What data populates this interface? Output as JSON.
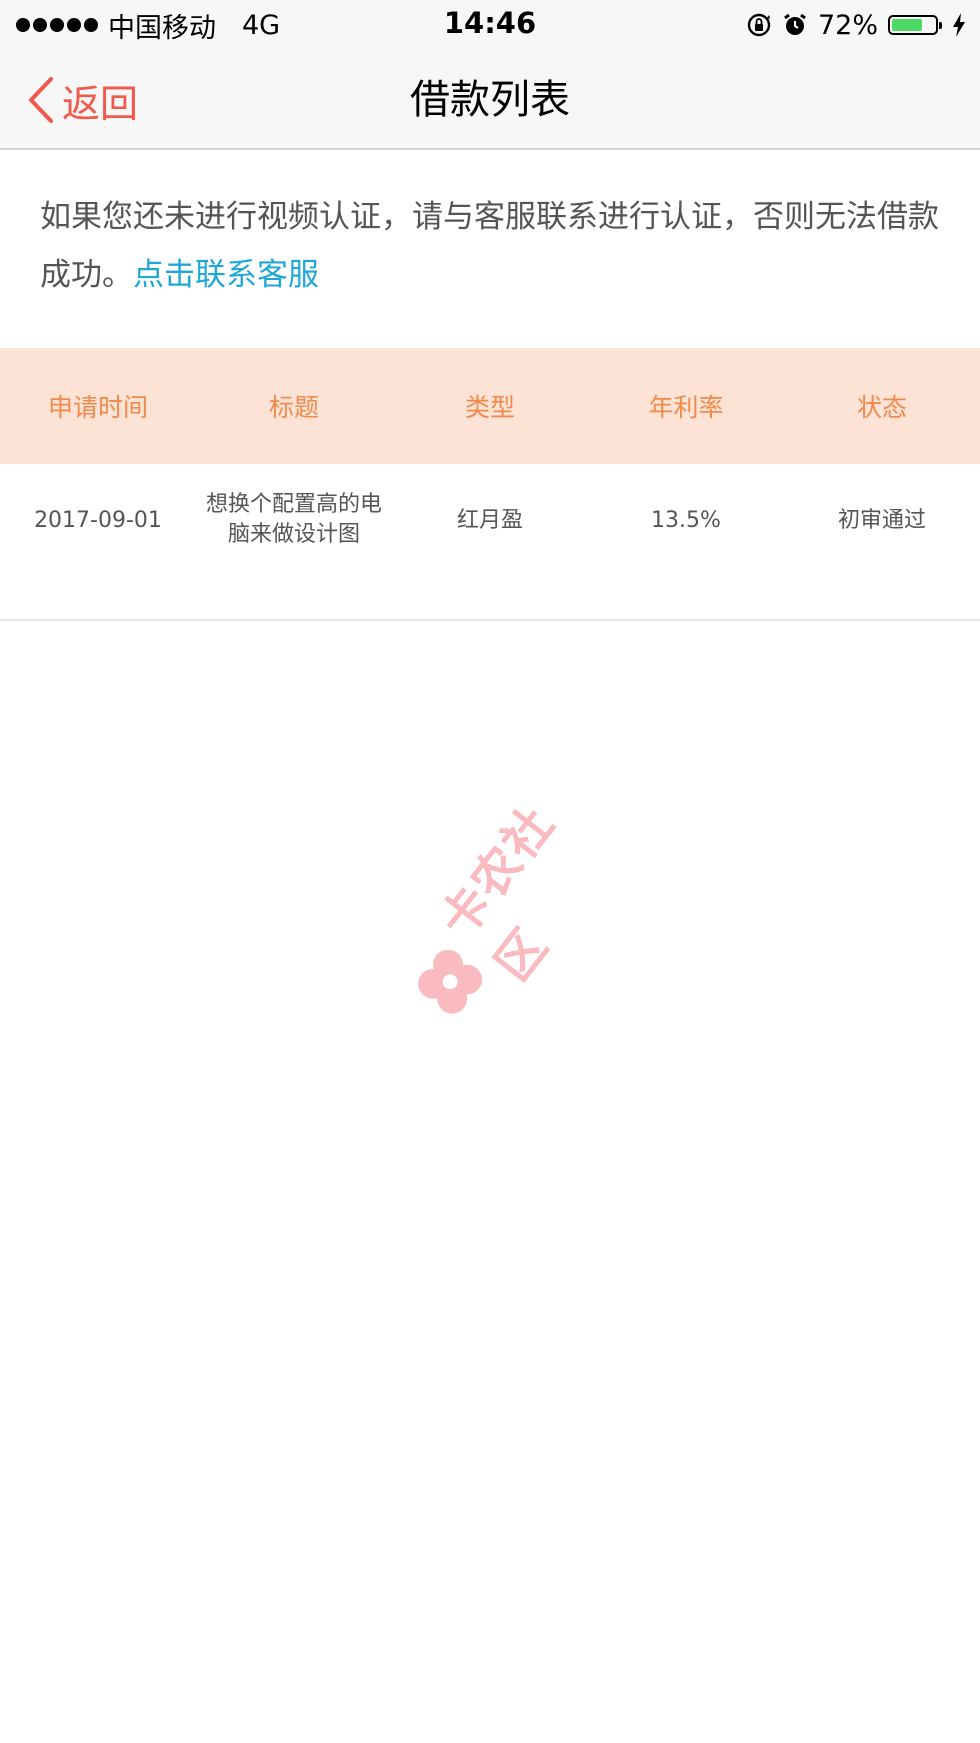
{
  "status_bar": {
    "carrier": "中国移动",
    "network": "4G",
    "time": "14:46",
    "battery_percent": "72%",
    "battery_level": 0.72,
    "icons": [
      "orientation-lock-icon",
      "alarm-icon",
      "battery-icon",
      "charging-icon"
    ]
  },
  "nav": {
    "back_label": "返回",
    "title": "借款列表"
  },
  "notice": {
    "text": "如果您还未进行视频认证，请与客服联系进行认证，否则无法借款成功。",
    "link_text": "点击联系客服"
  },
  "table": {
    "headers": [
      "申请时间",
      "标题",
      "类型",
      "年利率",
      "状态"
    ],
    "rows": [
      {
        "date": "2017-09-01",
        "title": "想换个配置高的电脑来做设计图",
        "type": "红月盈",
        "rate": "13.5%",
        "status": "初审通过"
      }
    ]
  },
  "watermark": {
    "text": "卡农社区"
  },
  "colors": {
    "accent_red": "#f15a4a",
    "link_blue": "#1ea7d8",
    "header_bg": "#fde3d6",
    "header_text": "#f08a4b",
    "watermark": "#f9b0b5"
  }
}
